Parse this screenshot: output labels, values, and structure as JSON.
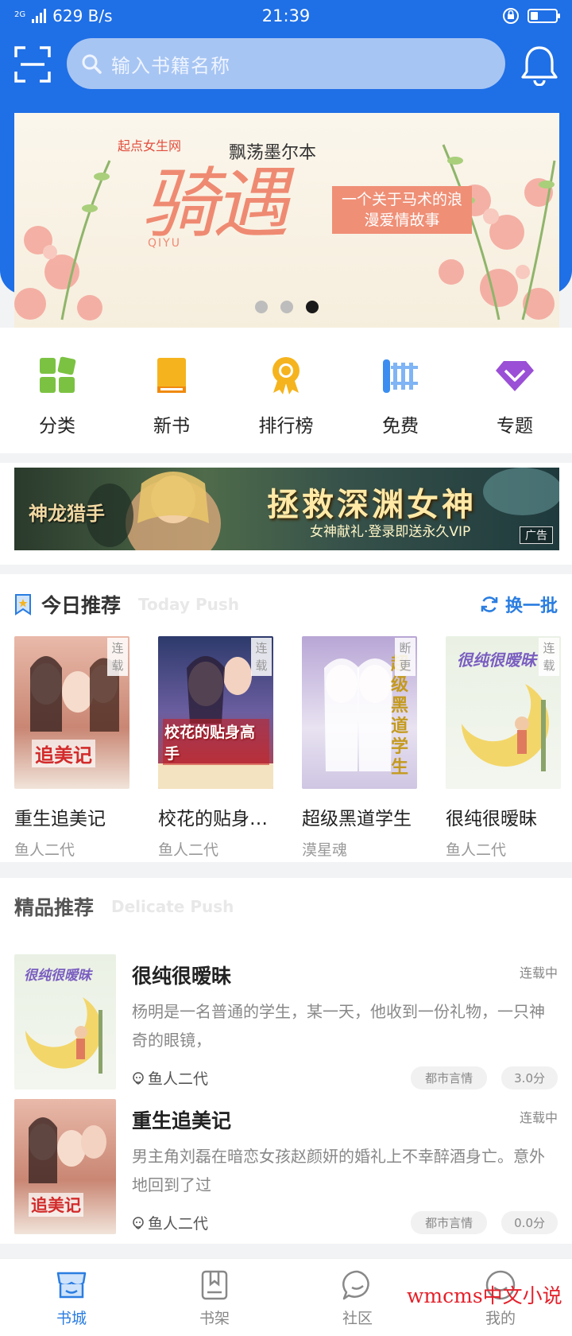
{
  "status_bar": {
    "network_type": "2G",
    "speed": "629 B/s",
    "time": "21:39",
    "battery_level": 0.3
  },
  "header": {
    "search_placeholder": "输入书籍名称"
  },
  "banner": {
    "brand": "起点女生网",
    "author": "飘荡墨尔本",
    "title": "骑遇",
    "title_pinyin": "QIYU",
    "tagline": "一个关于马术的浪漫爱情故事",
    "total_slides": 3,
    "active_slide": 3
  },
  "categories": [
    {
      "label": "分类",
      "icon": "grid-icon",
      "color": "#7cc242"
    },
    {
      "label": "新书",
      "icon": "book-icon",
      "color": "#f5b41e"
    },
    {
      "label": "排行榜",
      "icon": "medal-icon",
      "color": "#f5b41e"
    },
    {
      "label": "免费",
      "icon": "free-fence-icon",
      "color": "#3b8ef0"
    },
    {
      "label": "专题",
      "icon": "diamond-icon",
      "color": "#9a4fd6"
    }
  ],
  "ad": {
    "game_name": "神龙猎手",
    "headline": "拯救深渊女神",
    "subline": "女神献礼·登录即送永久VIP",
    "badge": "广告"
  },
  "today_push": {
    "title": "今日推荐",
    "title_en": "Today Push",
    "refresh_label": "换一批",
    "books": [
      {
        "name": "重生追美记",
        "author": "鱼人二代",
        "status": "连载",
        "cover_text": "追美记"
      },
      {
        "name": "校花的贴身…",
        "author": "鱼人二代",
        "status": "连载",
        "cover_text": "校花的贴身高手"
      },
      {
        "name": "超级黑道学生",
        "author": "漠星魂",
        "status": "断更",
        "cover_text": "超级黑道学生"
      },
      {
        "name": "很纯很暧昧",
        "author": "鱼人二代",
        "status": "连载",
        "cover_text": "很纯很暧昧"
      }
    ]
  },
  "delicate_push": {
    "title": "精品推荐",
    "title_en": "Delicate Push",
    "items": [
      {
        "name": "很纯很暧昧",
        "status": "连载中",
        "desc": "杨明是一名普通的学生，某一天，他收到一份礼物，一只神奇的眼镜，",
        "author": "鱼人二代",
        "genre": "都市言情",
        "score": "3.0分"
      },
      {
        "name": "重生追美记",
        "status": "连载中",
        "desc": "男主角刘磊在暗恋女孩赵颜妍的婚礼上不幸醉酒身亡。意外地回到了过",
        "author": "鱼人二代",
        "genre": "都市言情",
        "score": "0.0分"
      }
    ]
  },
  "tabbar": [
    {
      "label": "书城",
      "active": true
    },
    {
      "label": "书架",
      "active": false
    },
    {
      "label": "社区",
      "active": false
    },
    {
      "label": "我的",
      "active": false
    }
  ],
  "watermark": "wmcms中文小说",
  "colors": {
    "primary": "#1f6fe6",
    "accent": "#2a7de1"
  }
}
